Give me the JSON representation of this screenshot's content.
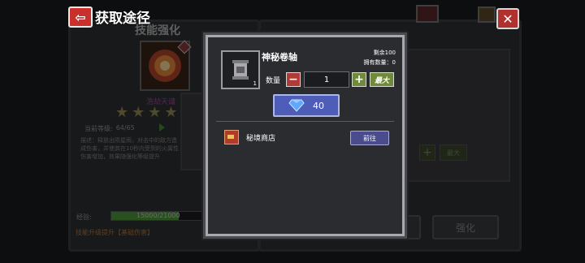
{
  "header": {
    "title": "获取途径"
  },
  "background": {
    "panel_title": "技能强化",
    "skill_name": "浩劫天谴",
    "current_level_label": "当前等级:",
    "current_level_value": "64/65",
    "description": "描述：释放出陨星雨，对击中的敌方造成伤害，并使其在10秒内受到的火属性伤害增加，效果随强化等级提升",
    "exp_label": "经验:",
    "exp_value": "15000/21000",
    "exp_fraction": 0.714,
    "upgrade_hint": "技能升级提升【基础伤害】",
    "max_label_dim": "最大",
    "enhance_button": "强化",
    "stars_count": 4
  },
  "modal": {
    "item_name": "神秘卷轴",
    "item_count": "1",
    "remaining": "剩余100",
    "owned": "拥有数量：0",
    "qty_label": "数量",
    "qty_value": "1",
    "minus": "−",
    "plus": "+",
    "max_label": "最大",
    "price": "40",
    "source_name": "秘境商店",
    "go_button": "前往"
  },
  "colors": {
    "gem": "#5fa8ff",
    "back_button": "#c9302c",
    "price_button": "#4d5db8",
    "plus_button": "#6f8a3a",
    "minus_button": "#b23a36"
  }
}
